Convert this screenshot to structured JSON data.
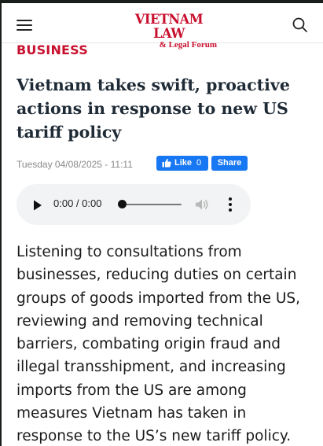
{
  "header": {
    "menu_icon": "hamburger-menu-icon",
    "logo_main": "VIETNAM LAW",
    "logo_sub": "& Legal Forum",
    "search_icon": "search-icon",
    "brand_color": "#c8102e"
  },
  "article": {
    "category": "BUSINESS",
    "title": "Vietnam takes swift, proactive actions in response to new US tariff policy",
    "date": "Tuesday 04/08/2025 - 11:11",
    "like_label": "Like",
    "like_count": "0",
    "share_label": "Share",
    "lead": "Listening to consultations from businesses, reducing duties on certain groups of goods imported from the US, reviewing and removing technical barriers, combating origin fraud and illegal transshipment, and increasing imports from the US are among measures Vietnam has taken in response to the US’s new tariff policy."
  },
  "audio": {
    "time": "0:00 / 0:00",
    "play_icon": "play-icon",
    "volume_icon": "volume-icon",
    "more_icon": "more-options-icon",
    "progress": 0
  },
  "colors": {
    "facebook_blue": "#1877f2",
    "title_text": "#1e2a35",
    "date_text": "#8a8a8a"
  }
}
